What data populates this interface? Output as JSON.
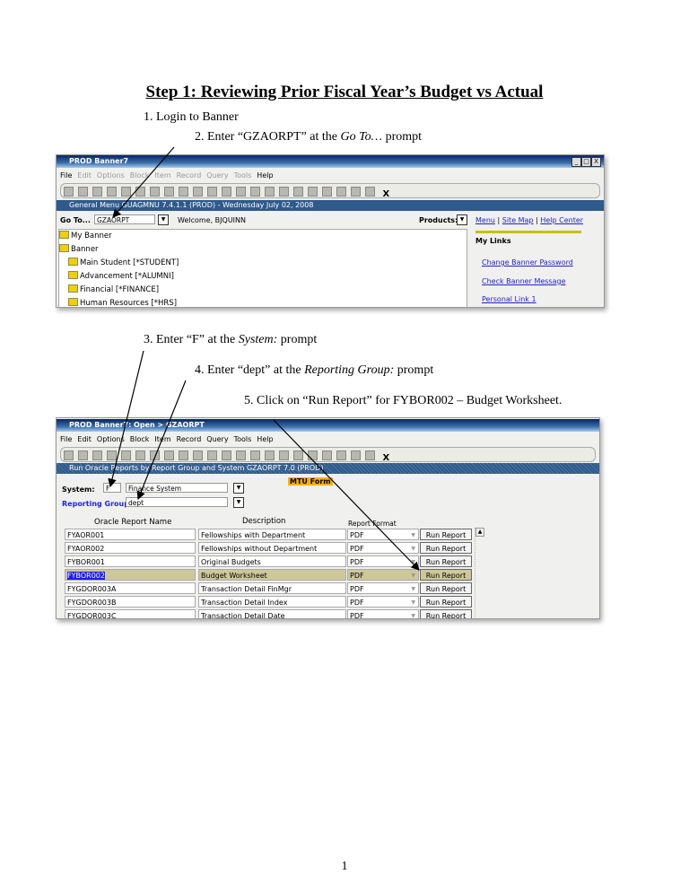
{
  "title": "Step 1: Reviewing Prior Fiscal Year’s Budget vs Actual",
  "steps": [
    "1.  Login to Banner",
    "2.  Enter “GZAORPT” at the",
    "3.  Enter “F” at the",
    "4.  Enter “dept” at the",
    "5.  Click on “Run Report” for FYBOR002 – Budget Worksheet."
  ],
  "step_italics": {
    "s2": "Go To…",
    "s2_tail": " prompt",
    "s3": "System:",
    "s3_tail": " prompt",
    "s4": "Reporting Group:",
    "s4_tail": " prompt"
  },
  "shot1": {
    "window_title": "PROD Banner7",
    "window_buttons": [
      "_",
      "□",
      "X"
    ],
    "menu": [
      "File",
      "Edit",
      "Options",
      "Block",
      "Item",
      "Record",
      "Query",
      "Tools",
      "Help"
    ],
    "toolbar_exit": "X",
    "form_title": "General Menu  GUAGMNU  7.4.1.1  (PROD) - Wednesday July 02, 2008",
    "goto_label": "Go To...",
    "goto_value": "GZAORPT",
    "welcome": "Welcome, BJQUINN",
    "products_label": "Products:",
    "top_links": [
      "Menu",
      "Site Map",
      "Help Center"
    ],
    "tree": [
      "My Banner",
      "Banner",
      "Main Student [*STUDENT]",
      "Advancement [*ALUMNI]",
      "Financial [*FINANCE]",
      "Human Resources [*HRS]"
    ],
    "my_links_title": "My Links",
    "my_links": [
      "Change Banner Password",
      "Check Banner Message",
      "Personal Link 1"
    ]
  },
  "shot2": {
    "window_title": "PROD Banner7: Open > GZAORPT",
    "menu": [
      "File",
      "Edit",
      "Options",
      "Block",
      "Item",
      "Record",
      "Query",
      "Tools",
      "Help"
    ],
    "toolbar_exit": "X",
    "form_title": "Run Oracle Reports by Report Group and System  GZAORPT  7.0  (PROD)",
    "badge": "MTU Form",
    "badge_color": "#ffb000",
    "system_label": "System:",
    "system_value": "F",
    "system_desc": "Finance System",
    "group_label": "Reporting Group:",
    "group_value": "dept",
    "headers": [
      "Oracle Report Name",
      "Description",
      "Report Format"
    ],
    "rows": [
      {
        "name": "FYAOR001",
        "desc": "Fellowships with Department",
        "format": "PDF",
        "button": "Run Report"
      },
      {
        "name": "FYAOR002",
        "desc": "Fellowships without Department",
        "format": "PDF",
        "button": "Run Report"
      },
      {
        "name": "FYBOR001",
        "desc": "Original Budgets",
        "format": "PDF",
        "button": "Run Report"
      },
      {
        "name": "FYBOR002",
        "desc": "Budget Worksheet",
        "format": "PDF",
        "button": "Run Report",
        "selected": true
      },
      {
        "name": "FYGDOR003A",
        "desc": "Transaction Detail FinMgr",
        "format": "PDF",
        "button": "Run Report"
      },
      {
        "name": "FYGDOR003B",
        "desc": "Transaction Detail Index",
        "format": "PDF",
        "button": "Run Report"
      },
      {
        "name": "FYGDOR003C",
        "desc": "Transaction Detail Date",
        "format": "PDF",
        "button": "Run Report"
      }
    ]
  },
  "page_number": "1"
}
